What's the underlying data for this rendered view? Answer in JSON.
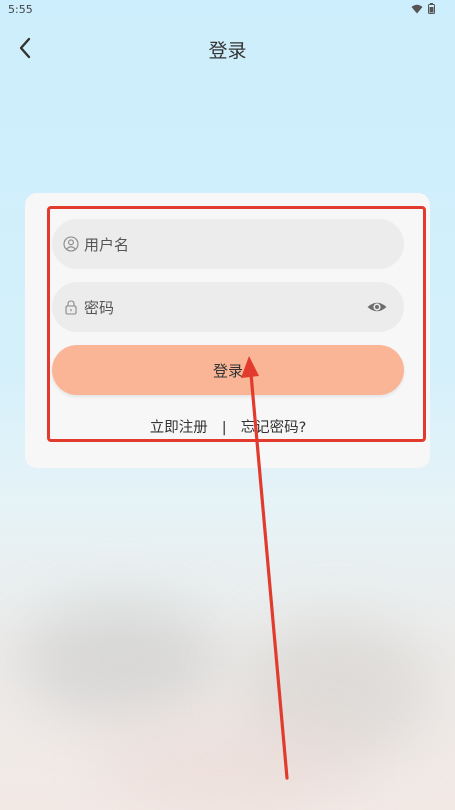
{
  "status_bar": {
    "time": "5:55"
  },
  "header": {
    "title": "登录"
  },
  "form": {
    "username_placeholder": "用户名",
    "password_placeholder": "密码",
    "login_label": "登录"
  },
  "links": {
    "register": "立即注册",
    "separator": "|",
    "forgot": "忘记密码?"
  },
  "colors": {
    "accent": "#f9b596",
    "annotation": "#e23b2e"
  },
  "icons": [
    "wifi-icon",
    "battery-icon",
    "back-arrow-icon",
    "user-icon",
    "lock-icon",
    "eye-icon"
  ]
}
